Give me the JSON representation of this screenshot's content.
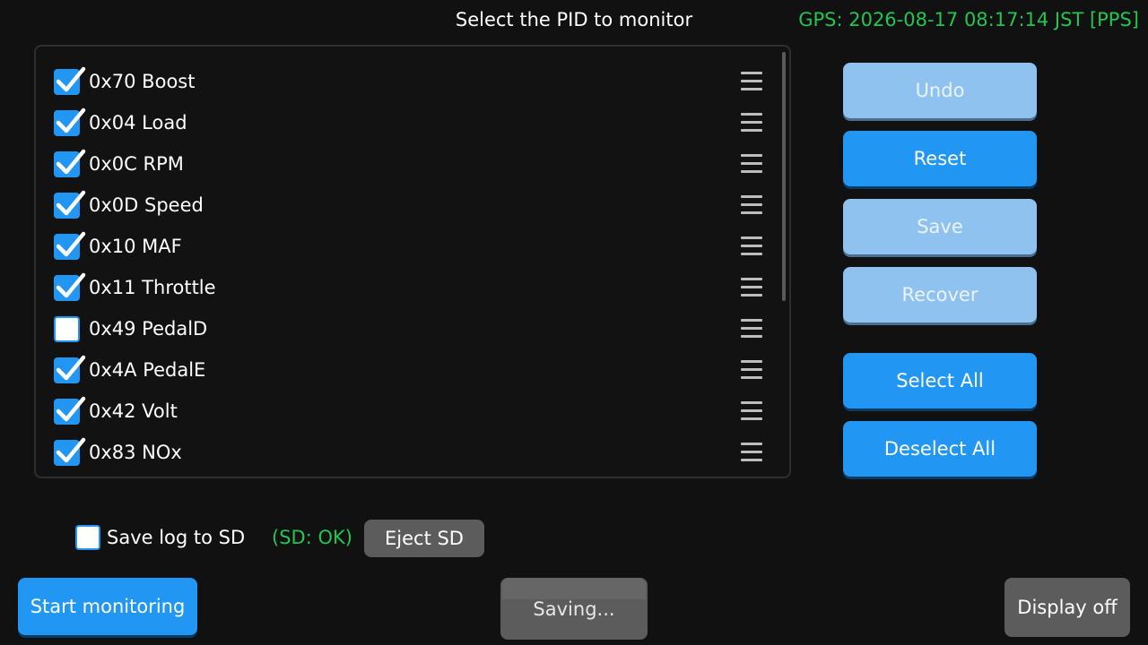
{
  "header": {
    "title": "Select the PID to monitor",
    "gps": "GPS: 2026-08-17 08:17:14 JST  [PPS]"
  },
  "pid_list": {
    "items": [
      {
        "label": "0x70 Boost",
        "checked": true
      },
      {
        "label": "0x04 Load",
        "checked": true
      },
      {
        "label": "0x0C RPM",
        "checked": true
      },
      {
        "label": "0x0D Speed",
        "checked": true
      },
      {
        "label": "0x10 MAF",
        "checked": true
      },
      {
        "label": "0x11 Throttle",
        "checked": true
      },
      {
        "label": "0x49 PedalD",
        "checked": false
      },
      {
        "label": "0x4A PedalE",
        "checked": true
      },
      {
        "label": "0x42 Volt",
        "checked": true
      },
      {
        "label": "0x83 NOx",
        "checked": true
      }
    ],
    "drag_icon": "drag-handle-icon",
    "check_icon": "checkmark-icon"
  },
  "actions": {
    "undo": "Undo",
    "reset": "Reset",
    "save": "Save",
    "recover": "Recover",
    "select_all": "Select All",
    "deselect_all": "Deselect All"
  },
  "sd": {
    "label": "Save log to SD",
    "checked": false,
    "status": "(SD: OK)",
    "eject": "Eject SD"
  },
  "footer": {
    "start": "Start monitoring",
    "saving": "Saving...",
    "display_off": "Display off"
  },
  "colors": {
    "accent": "#2196f3",
    "accent_disabled": "#8fc2ee",
    "status_ok": "#23c552",
    "background": "#111111",
    "gray_button": "#5c5c5c"
  }
}
